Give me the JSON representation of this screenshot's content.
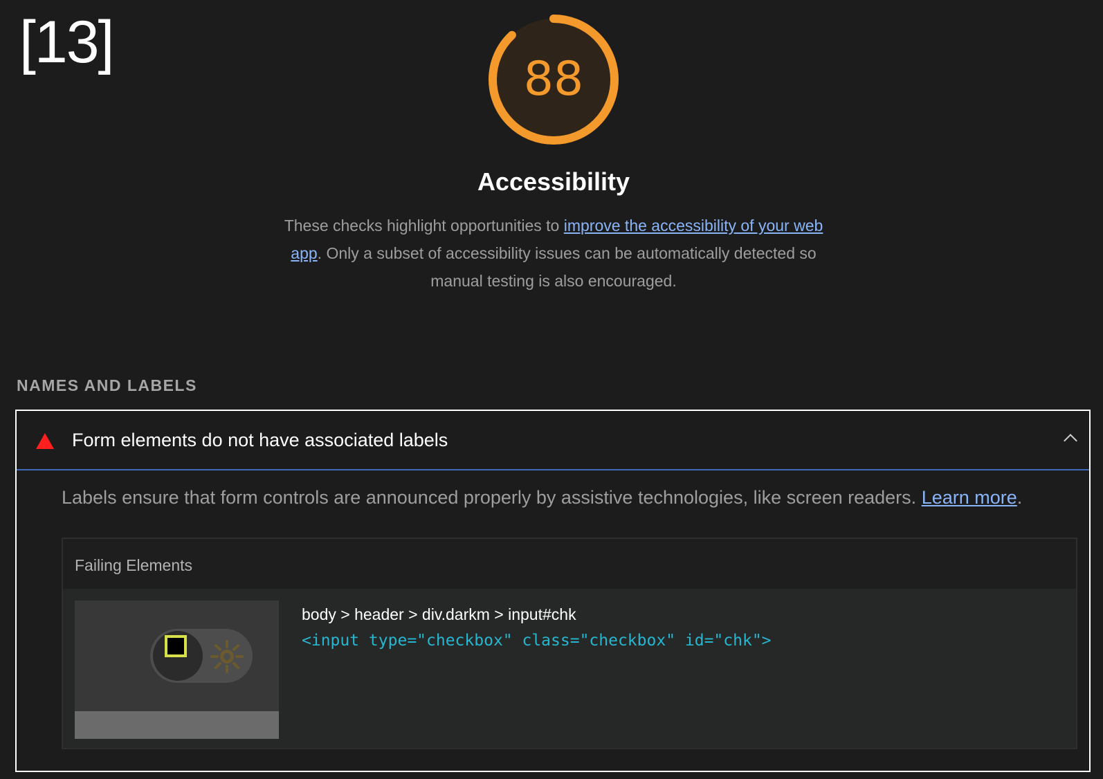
{
  "slide_number": "[13]",
  "gauge": {
    "score": "88",
    "score_fraction": 0.88,
    "color": "#f4992b"
  },
  "category": {
    "title": "Accessibility",
    "desc_before": "These checks highlight opportunities to ",
    "desc_link": "improve the accessibility of your web app",
    "desc_after": ". Only a subset of accessibility issues can be automatically detected so manual testing is also encouraged."
  },
  "group": {
    "title": "NAMES AND LABELS"
  },
  "audit": {
    "title": "Form elements do not have associated labels",
    "status_icon": "fail-triangle-icon",
    "status_color": "#ff1f1f",
    "desc_before": "Labels ensure that form controls are announced properly by assistive technologies, like screen readers. ",
    "desc_link": "Learn more",
    "desc_after": ".",
    "table": {
      "header": "Failing Elements",
      "rows": [
        {
          "selector": "body > header > div.darkm > input#chk",
          "snippet": "<input type=\"checkbox\" class=\"checkbox\" id=\"chk\">"
        }
      ]
    }
  }
}
